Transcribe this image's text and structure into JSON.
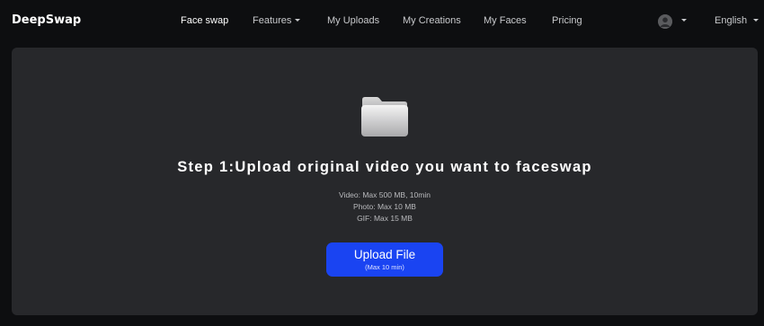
{
  "header": {
    "logo": "DeepSwap",
    "nav": [
      {
        "label": "Face swap",
        "active": true
      },
      {
        "label": "Features",
        "dropdown": true
      },
      {
        "label": "My Uploads"
      },
      {
        "label": "My Creations"
      },
      {
        "label": "My Faces"
      },
      {
        "label": "Pricing"
      }
    ],
    "language": "English",
    "icons": {
      "avatar": "user-avatar-icon",
      "dropdown": "chevron-down-icon"
    }
  },
  "main": {
    "icon": "folder-icon",
    "title": "Step 1:Upload original video you want to faceswap",
    "limits": [
      "Video: Max 500 MB, 10min",
      "Photo: Max 10 MB",
      "GIF: Max 15 MB"
    ],
    "upload_button": {
      "label": "Upload File",
      "sublabel": "(Max 10 min)",
      "color": "#1a44f2"
    }
  },
  "colors": {
    "background": "#0d0e10",
    "panel": "#27282b",
    "accent": "#1a44f2"
  }
}
